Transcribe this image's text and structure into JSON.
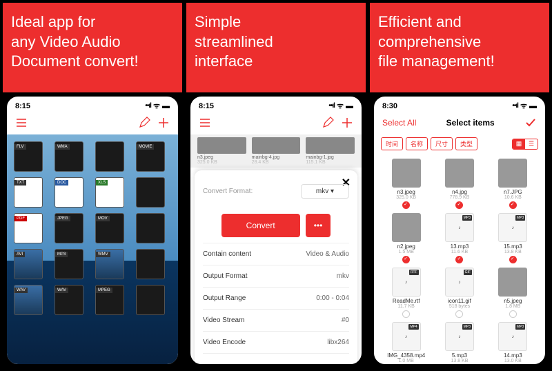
{
  "headers": {
    "s1": {
      "line1": "Ideal app for",
      "line2": "any Video Audio",
      "line3": "Document convert!"
    },
    "s2": {
      "line1": "Simple",
      "line2": "streamlined",
      "line3": "interface"
    },
    "s3": {
      "line1": "Efficient and",
      "line2": "comprehensive",
      "line3": "file management!"
    }
  },
  "s1": {
    "time": "8:15",
    "filetypes": [
      "FLV",
      "WMA",
      "",
      "MOVIE",
      "TXT",
      "DOC",
      "XLS",
      "",
      "PDF",
      "JPEG",
      "MOV",
      "",
      "AVI",
      "MP3",
      "WMV",
      "",
      "WAV",
      "WAV",
      "MPEG",
      ""
    ]
  },
  "s2": {
    "time": "8:15",
    "thumbs": [
      {
        "name": "n3.jpeg",
        "size": "325.0 KB"
      },
      {
        "name": "mainbg-4.jpg",
        "size": "28.4 KB"
      },
      {
        "name": "mainbg-1.jpg",
        "size": "115.1 KB"
      }
    ],
    "sheet": {
      "title_label": "Convert Format:",
      "format": "mkv",
      "convert_btn": "Convert",
      "more_btn": "•••",
      "rows": [
        {
          "label": "Contain content",
          "value": "Video & Audio"
        },
        {
          "label": "Output Format",
          "value": "mkv"
        },
        {
          "label": "Output Range",
          "value": "0:00 - 0:04"
        },
        {
          "label": "Video Stream",
          "value": "#0"
        },
        {
          "label": "Video Encode",
          "value": "libx264"
        }
      ]
    }
  },
  "s3": {
    "time": "8:30",
    "select_all": "Select All",
    "title": "Select items",
    "pills": [
      "时间",
      "名称",
      "尺寸",
      "类型"
    ],
    "items": [
      {
        "name": "n3.jpeg",
        "size": "325.0 KB",
        "sel": true,
        "type": "img"
      },
      {
        "name": "n4.jpg",
        "size": "778.9 KB",
        "sel": true,
        "type": "img"
      },
      {
        "name": "n7.JPG",
        "size": "10.6 KB",
        "sel": true,
        "type": "img"
      },
      {
        "name": "n2.jpeg",
        "size": "1.5 MB",
        "sel": true,
        "type": "img"
      },
      {
        "name": "13.mp3",
        "size": "11.6 KB",
        "sel": true,
        "type": "mp3"
      },
      {
        "name": "15.mp3",
        "size": "13.8 KB",
        "sel": true,
        "type": "mp3"
      },
      {
        "name": "ReadMe.rtf",
        "size": "11.7 KB",
        "sel": false,
        "type": "rtf"
      },
      {
        "name": "icon11.gif",
        "size": "518 bytes",
        "sel": false,
        "type": "gif"
      },
      {
        "name": "n5.jpeg",
        "size": "1.8 MB",
        "sel": false,
        "type": "img"
      },
      {
        "name": "IMG_4358.mp4",
        "size": "1.0 MB",
        "sel": false,
        "type": "mp4"
      },
      {
        "name": "5.mp3",
        "size": "13.8 KB",
        "sel": false,
        "type": "mp3"
      },
      {
        "name": "14.mp3",
        "size": "13.0 KB",
        "sel": false,
        "type": "mp3"
      }
    ]
  }
}
